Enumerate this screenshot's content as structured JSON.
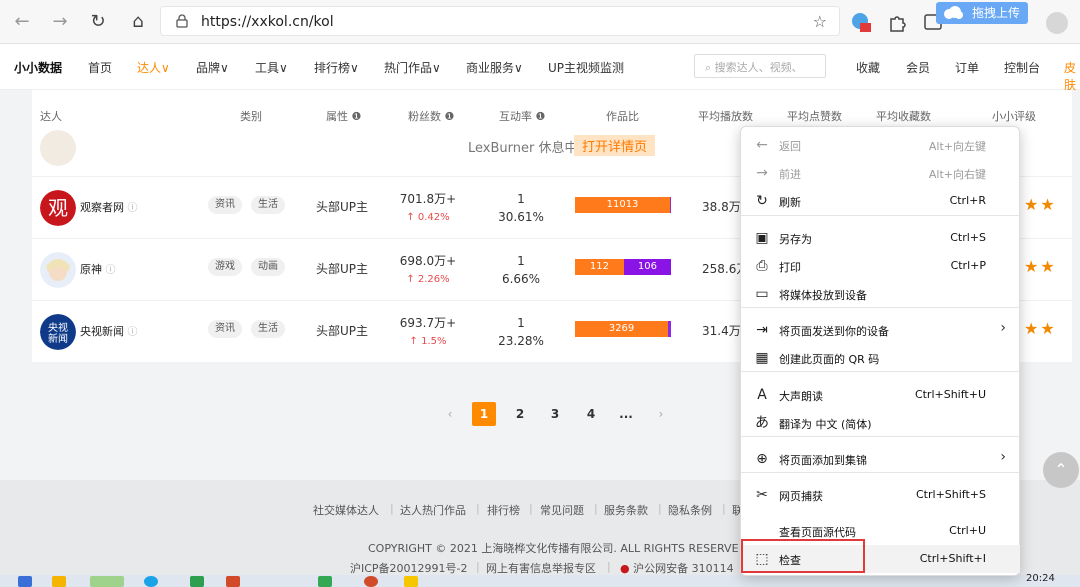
{
  "browser": {
    "url": "https://xxkol.cn/kol",
    "float_upload_label": "拖拽上传"
  },
  "site": {
    "logo": "小小数据",
    "menu": [
      "首页",
      "达人∨",
      "品牌∨",
      "工具∨",
      "排行榜∨",
      "热门作品∨",
      "商业服务∨",
      "UP主视频监测"
    ],
    "search_placeholder": "搜索达人、视频、",
    "right_links": [
      "收藏",
      "会员",
      "订单",
      "控制台",
      "皮肤"
    ]
  },
  "table": {
    "headers": [
      "达人",
      "类别",
      "属性",
      "粉丝数",
      "互动率",
      "作品比",
      "平均播放数",
      "平均点赞数",
      "平均收藏数",
      "小小评级"
    ],
    "rest_tip": "LexBurner 休息中,",
    "rest_link": "打开详情页",
    "rows": [
      {
        "name": "观察者网",
        "tags": [
          "资讯",
          "生活"
        ],
        "attr": "头部UP主",
        "fans": "701.8万+",
        "fans_change": "↑ 0.42%",
        "inter_top": "1",
        "inter_rate": "30.61%",
        "bar": [
          {
            "label": "11013",
            "color": "#ff7a1a",
            "share": 0.99
          },
          {
            "label": "",
            "color": "#8a2be2",
            "share": 0.01
          }
        ],
        "avg_play": "38.8万-",
        "rating": "★★"
      },
      {
        "name": "原神",
        "tags": [
          "游戏",
          "动画"
        ],
        "attr": "头部UP主",
        "fans": "698.0万+",
        "fans_change": "↑ 2.26%",
        "inter_top": "1",
        "inter_rate": "6.66%",
        "bar": [
          {
            "label": "112",
            "color": "#ff7a1a",
            "share": 0.51
          },
          {
            "label": "106",
            "color": "#8a14e6",
            "share": 0.49
          }
        ],
        "avg_play": "258.6万",
        "rating": "★★"
      },
      {
        "name": "央视新闻",
        "tags": [
          "资讯",
          "生活"
        ],
        "attr": "头部UP主",
        "fans": "693.7万+",
        "fans_change": "↑ 1.5%",
        "inter_top": "1",
        "inter_rate": "23.28%",
        "bar": [
          {
            "label": "3269",
            "color": "#ff7a1a",
            "share": 0.97
          },
          {
            "label": "",
            "color": "#8a2be2",
            "share": 0.03
          }
        ],
        "avg_play": "31.4万-",
        "rating": "★★"
      }
    ]
  },
  "pagination": {
    "pages": [
      "1",
      "2",
      "3",
      "4",
      "..."
    ],
    "current": "1",
    "prev": "‹",
    "next": "›"
  },
  "footer": {
    "links": [
      "社交媒体达人",
      "达人热门作品",
      "排行榜",
      "常见问题",
      "服务条款",
      "隐私条例",
      "联"
    ],
    "copyright": "COPYRIGHT © 2021 上海晓桦文化传播有限公司. ALL RIGHTS RESERVE",
    "icp": "沪ICP备20012991号-2",
    "report": "网上有害信息举报专区",
    "police": "沪公网安备 310114"
  },
  "taskbar": {
    "clock": "20:24"
  },
  "context_menu": {
    "items": [
      {
        "icon": "←",
        "icon_name": "back-arrow-icon",
        "label": "返回",
        "shortcut": "Alt+向左键",
        "disabled": true
      },
      {
        "icon": "→",
        "icon_name": "forward-arrow-icon",
        "label": "前进",
        "shortcut": "Alt+向右键",
        "disabled": true
      },
      {
        "icon": "↻",
        "icon_name": "refresh-icon",
        "label": "刷新",
        "shortcut": "Ctrl+R"
      },
      {
        "icon": "▣",
        "icon_name": "save-as-icon",
        "label": "另存为",
        "shortcut": "Ctrl+S"
      },
      {
        "icon": "⎙",
        "icon_name": "print-icon",
        "label": "打印",
        "shortcut": "Ctrl+P"
      },
      {
        "icon": "▭",
        "icon_name": "cast-icon",
        "label": "将媒体投放到设备",
        "shortcut": ""
      },
      {
        "icon": "⇥",
        "icon_name": "send-to-device-icon",
        "label": "将页面发送到你的设备",
        "shortcut": "",
        "submenu": true
      },
      {
        "icon": "▦",
        "icon_name": "qr-code-icon",
        "label": "创建此页面的 QR 码",
        "shortcut": ""
      },
      {
        "icon": "A",
        "icon_name": "read-aloud-icon",
        "label": "大声朗读",
        "shortcut": "Ctrl+Shift+U"
      },
      {
        "icon": "あ",
        "icon_name": "translate-icon",
        "label": "翻译为 中文 (简体)",
        "shortcut": ""
      },
      {
        "icon": "⊕",
        "icon_name": "add-collection-icon",
        "label": "将页面添加到集锦",
        "shortcut": "",
        "submenu": true
      },
      {
        "icon": "✂",
        "icon_name": "web-capture-icon",
        "label": "网页捕获",
        "shortcut": "Ctrl+Shift+S"
      },
      {
        "icon": "",
        "icon_name": "",
        "label": "查看页面源代码",
        "shortcut": "Ctrl+U"
      },
      {
        "icon": "⬚",
        "icon_name": "inspect-icon",
        "label": "检查",
        "shortcut": "Ctrl+Shift+I",
        "hover": true
      }
    ]
  }
}
